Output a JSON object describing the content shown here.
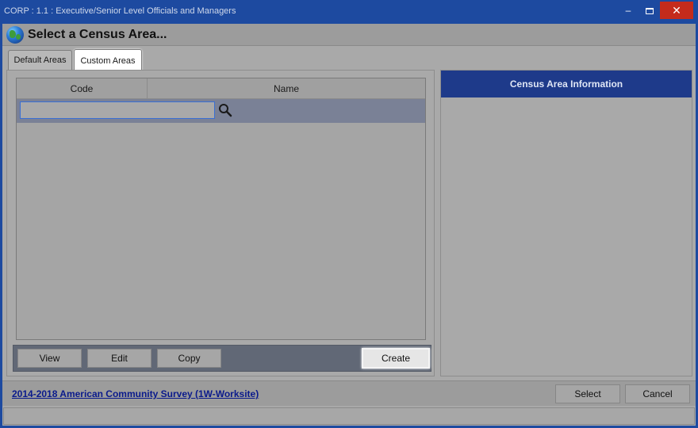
{
  "window": {
    "title": "CORP : 1.1 : Executive/Senior Level Officials and Managers",
    "controls": {
      "minimize": "–",
      "maximize": "□",
      "close": "✕"
    }
  },
  "header": {
    "title": "Select a Census Area...",
    "icon": "globe-icon"
  },
  "tabs": [
    {
      "label": "Default Areas",
      "selected": false
    },
    {
      "label": "Custom Areas",
      "selected": true
    }
  ],
  "grid": {
    "columns": [
      "Code",
      "Name"
    ],
    "filter": {
      "value": "",
      "placeholder": ""
    },
    "rows": []
  },
  "buttons": {
    "view": "View",
    "edit": "Edit",
    "copy": "Copy",
    "create": "Create"
  },
  "info_panel": {
    "title": "Census Area Information"
  },
  "footer": {
    "survey_link": "2014-2018 American Community Survey (1W-Worksite)",
    "select": "Select",
    "cancel": "Cancel"
  },
  "colors": {
    "titlebar": "#1d4aa0",
    "close_button": "#c42b1c",
    "info_header": "#1e3a8a",
    "link": "#0a1a8c"
  }
}
